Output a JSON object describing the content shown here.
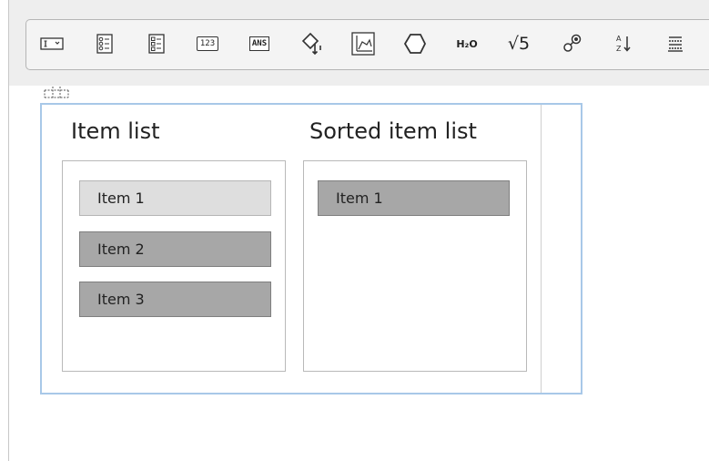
{
  "toolbar": {
    "buttons": [
      {
        "icon": "text-entry-icon"
      },
      {
        "icon": "multiple-choice-icon"
      },
      {
        "icon": "checkbox-list-icon"
      },
      {
        "icon": "numeric-entry-icon",
        "text": "123"
      },
      {
        "icon": "answer-box-icon",
        "text": "ANS"
      },
      {
        "icon": "hotspot-icon"
      },
      {
        "icon": "graph-icon"
      },
      {
        "icon": "polygon-icon"
      },
      {
        "icon": "chemistry-icon",
        "text": "H₂O"
      },
      {
        "icon": "math-sqrt-icon",
        "text": "√5"
      },
      {
        "icon": "molecule-icon"
      },
      {
        "icon": "sort-icon",
        "text": "A↓Z"
      },
      {
        "icon": "list-lines-icon"
      }
    ]
  },
  "widget": {
    "left_title": "Item list",
    "right_title": "Sorted item list",
    "left_items": [
      "Item 1",
      "Item 2",
      "Item 3"
    ],
    "right_items": [
      "Item 1"
    ]
  },
  "colors": {
    "item_selected": "#a7a7a7",
    "item_placeholder": "#dedede",
    "editor_border": "#a8c8e8"
  }
}
